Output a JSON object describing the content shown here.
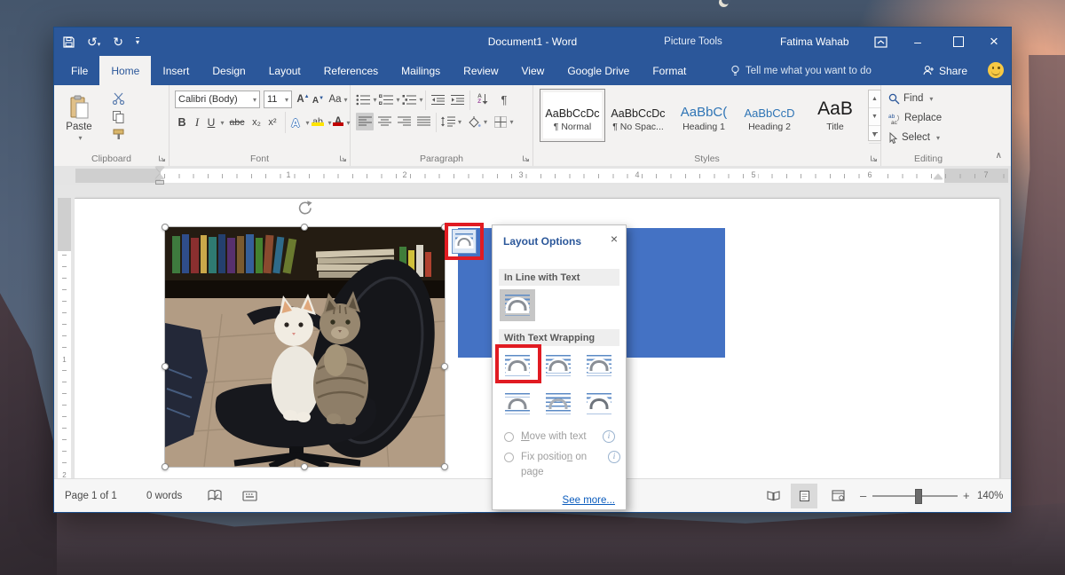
{
  "titlebar": {
    "title": "Document1 - Word",
    "contextual_header": "Picture Tools",
    "user": "Fatima Wahab"
  },
  "icons": {
    "undo": "↺",
    "redo": "↻",
    "qat_more": "▾",
    "minimize": "–",
    "close": "×",
    "popup_close": "×",
    "collapse_ribbon": "∧",
    "tab_selector": "∟",
    "info": "i"
  },
  "tabs": [
    {
      "label": "File"
    },
    {
      "label": "Home"
    },
    {
      "label": "Insert"
    },
    {
      "label": "Design"
    },
    {
      "label": "Layout"
    },
    {
      "label": "References"
    },
    {
      "label": "Mailings"
    },
    {
      "label": "Review"
    },
    {
      "label": "View"
    },
    {
      "label": "Google Drive"
    },
    {
      "label": "Format"
    }
  ],
  "tellme": "Tell me what you want to do",
  "share": "Share",
  "ribbon": {
    "clipboard": {
      "label": "Clipboard",
      "paste": "Paste"
    },
    "font": {
      "label": "Font",
      "name": "Calibri (Body)",
      "size": "11",
      "grow": "A",
      "shrink": "A",
      "case": "Aa",
      "clear": "A",
      "bold": "B",
      "italic": "I",
      "underline": "U",
      "strike": "abc",
      "subscript": "x₂",
      "superscript": "x²",
      "effects": "A",
      "highlight": "ab",
      "color": "A"
    },
    "paragraph": {
      "label": "Paragraph",
      "pilcrow": "¶",
      "sort_a": "A",
      "sort_z": "Z"
    },
    "styles": {
      "label": "Styles",
      "items": [
        {
          "sample": "AaBbCcDc",
          "name": "¶ Normal"
        },
        {
          "sample": "AaBbCcDc",
          "name": "¶ No Spac..."
        },
        {
          "sample": "AaBbC(",
          "name": "Heading 1"
        },
        {
          "sample": "AaBbCcD",
          "name": "Heading 2"
        },
        {
          "sample": "AaB",
          "name": "Title"
        }
      ]
    },
    "editing": {
      "label": "Editing",
      "find": "Find",
      "replace": "Replace",
      "select": "Select"
    }
  },
  "ruler": {
    "numbers": [
      "1",
      "2",
      "3",
      "4",
      "5",
      "6",
      "7"
    ],
    "v_numbers": [
      "1",
      "2"
    ]
  },
  "layout_options": {
    "title": "Layout Options",
    "inline_header": "In Line with Text",
    "wrap_header": "With Text Wrapping",
    "move_m": "M",
    "move_rest": "ove with text",
    "fix_pre": "Fix positio",
    "fix_n": "n",
    "fix_post": " on",
    "fix_line2": "page",
    "see_more": "See more..."
  },
  "statusbar": {
    "page": "Page 1 of 1",
    "words": "0 words",
    "zoom": "140%",
    "zoom_out": "–",
    "zoom_in": "+"
  },
  "colors": {
    "accent_blue": "#2b579a",
    "shape_blue": "#4472c4",
    "annotation_red": "#e11b22",
    "highlight_yellow": "#ffe400",
    "font_color_red": "#c00000"
  }
}
